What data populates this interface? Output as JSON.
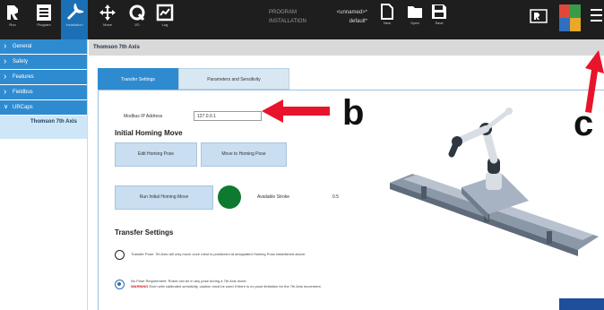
{
  "topbar": {
    "left_icons": [
      {
        "name": "run",
        "label": "Run",
        "icon": "robot-logo-icon"
      },
      {
        "name": "program",
        "label": "Program",
        "icon": "program-list-icon"
      },
      {
        "name": "installation",
        "label": "Installation",
        "icon": "installation-icon"
      },
      {
        "name": "move",
        "label": "Move",
        "icon": "move-arrows-icon"
      },
      {
        "name": "io",
        "label": "I/O",
        "icon": "io-icon"
      },
      {
        "name": "log",
        "label": "Log",
        "icon": "log-chart-icon"
      }
    ],
    "program_label": "PROGRAM",
    "program_value": "<unnamed>*",
    "installation_label": "INSTALLATION",
    "installation_value": "default*",
    "file_buttons": [
      {
        "label": "New",
        "icon": "new-file-icon"
      },
      {
        "label": "Open",
        "icon": "open-folder-icon"
      },
      {
        "label": "Save",
        "icon": "save-icon"
      }
    ],
    "colors": {
      "bar": "#1e1e1e",
      "active": "#1a6fb5"
    }
  },
  "sidebar": {
    "items": [
      {
        "label": "General"
      },
      {
        "label": "Safety"
      },
      {
        "label": "Features"
      },
      {
        "label": "Fieldbus"
      },
      {
        "label": "URCaps"
      }
    ],
    "sub_item": "Thomson 7th Axis"
  },
  "main": {
    "title": "Thomson 7th Axis",
    "tabs": [
      {
        "label": "Transfer Settings"
      },
      {
        "label": "Parameters and Sensitivity"
      }
    ],
    "ip_label": "Modbus IP Address",
    "ip_value": "127.0.0.1",
    "homing_title": "Initial Homing Move",
    "edit_home_button": "Edit Homing Pose",
    "move_home_button": "Move to Homing Pose",
    "run_home_button": "Run Initial Homing Move",
    "accel_label": "Available Stroke",
    "accel_value": "0.5",
    "transfer_title": "Transfer Settings",
    "option1": "Transfer Pose: 7th Axis will only move once robot is positioned at designated Homing Pose established above.",
    "option2_line1": "No Pose Requirement: Robot can be in any pose during a 7th Axis move.",
    "option2_warning": "WARNING",
    "option2_line2": " Even with calibrated sensitivity, caution must be used if there is no pose limitation for the 7th Axis movement.",
    "status_color": "#0e7a2f"
  },
  "annotations": {
    "b": "b",
    "c": "c",
    "arrow_color": "#e8142c"
  }
}
